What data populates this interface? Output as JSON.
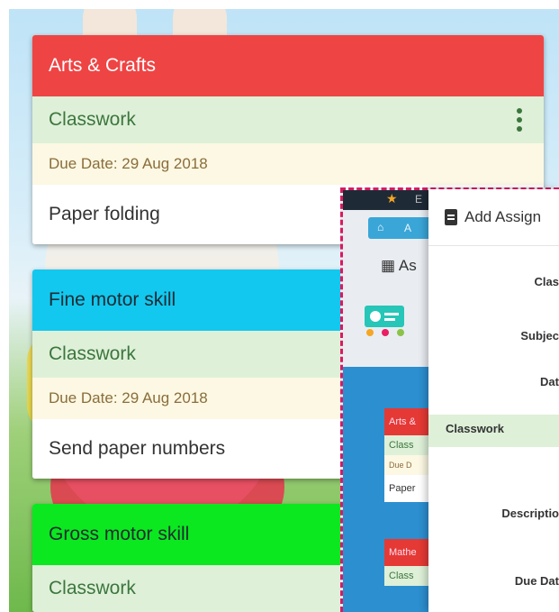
{
  "cards": [
    {
      "title": "Arts & Crafts",
      "color": "#ef4444",
      "title_color": "#ffffff",
      "type": "Classwork",
      "due": "Due Date: 29 Aug 2018",
      "desc": "Paper folding"
    },
    {
      "title": "Fine motor skill",
      "color": "#12c8ef",
      "title_color": "#1d2b33",
      "type": "Classwork",
      "due": "Due Date: 29 Aug 2018",
      "desc": "Send paper numbers"
    },
    {
      "title": "Gross motor skill",
      "color": "#0be81f",
      "title_color": "#1d2b33",
      "type": "Classwork"
    }
  ],
  "overlay": {
    "topbar_text": "E",
    "breadcrumb_text": "A",
    "title": "As",
    "mini_cards": [
      {
        "title": "Arts &",
        "type": "Class",
        "due": "Due D",
        "desc": "Paper"
      },
      {
        "title": "Mathe",
        "type": "Class"
      }
    ]
  },
  "modal": {
    "title": "Add Assign",
    "labels": {
      "class": "Clas",
      "subject": "Subjec",
      "date": "Dat",
      "description": "Descriptio",
      "due_date": "Due Dat"
    },
    "classwork": "Classwork"
  }
}
